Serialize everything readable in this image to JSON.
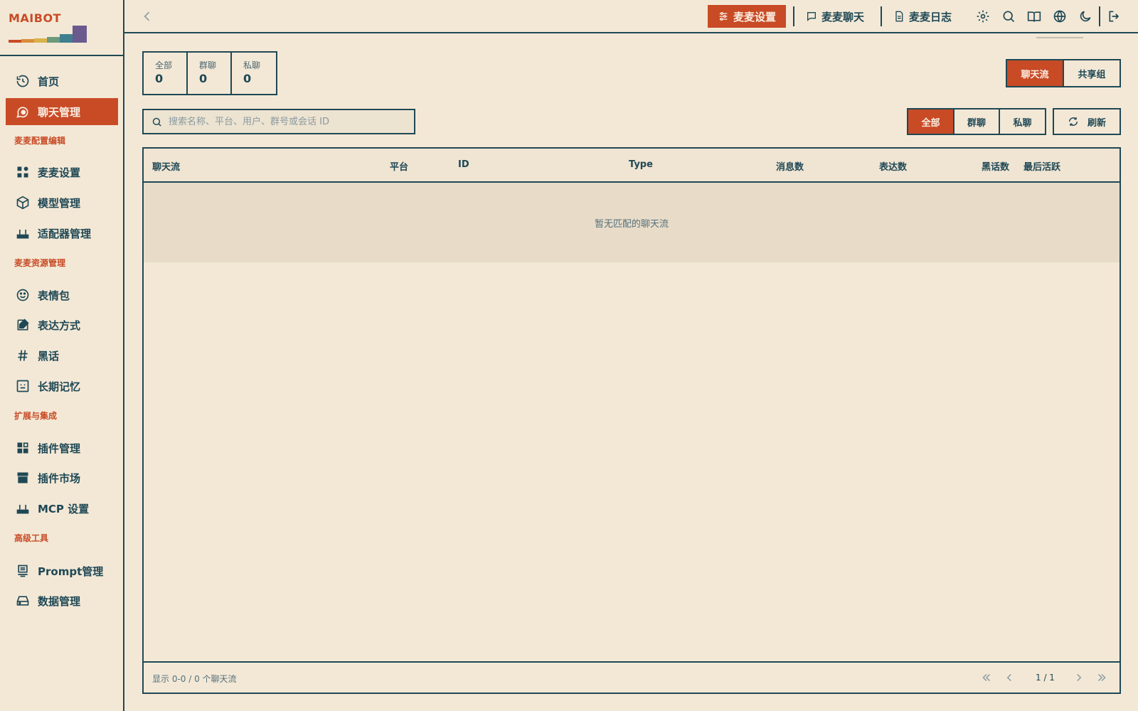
{
  "app": {
    "logo": "MAIBOT"
  },
  "colors": {
    "accent": "#c84b26",
    "ink": "#1f4855",
    "background": "#f3e8d6"
  },
  "sidebar": {
    "items": [
      {
        "label": "首页",
        "icon": "history-icon"
      },
      {
        "label": "聊天管理",
        "icon": "chat-bubble-icon",
        "active": true
      },
      {
        "label": "麦麦设置",
        "icon": "widgets-icon"
      },
      {
        "label": "模型管理",
        "icon": "cube-icon"
      },
      {
        "label": "适配器管理",
        "icon": "router-icon"
      },
      {
        "label": "表情包",
        "icon": "smile-icon"
      },
      {
        "label": "表达方式",
        "icon": "edit-note-icon"
      },
      {
        "label": "黑话",
        "icon": "hash-icon"
      },
      {
        "label": "长期记忆",
        "icon": "memory-icon"
      },
      {
        "label": "插件管理",
        "icon": "plugin-grid-icon"
      },
      {
        "label": "插件市场",
        "icon": "store-icon"
      },
      {
        "label": "MCP 设置",
        "icon": "router-icon"
      },
      {
        "label": "Prompt管理",
        "icon": "document-icon"
      },
      {
        "label": "数据管理",
        "icon": "drive-icon"
      }
    ],
    "sections": [
      "麦麦配置编辑",
      "麦麦资源管理",
      "扩展与集成",
      "高级工具"
    ]
  },
  "topbar": {
    "nav": [
      {
        "label": "麦麦设置",
        "icon": "sliders-icon",
        "active": true
      },
      {
        "label": "麦麦聊天",
        "icon": "message-icon"
      },
      {
        "label": "麦麦日志",
        "icon": "file-icon"
      }
    ],
    "icons": [
      "gear-icon",
      "search-icon",
      "book-icon",
      "globe-icon",
      "moon-icon",
      "logout-icon"
    ]
  },
  "stats": [
    {
      "label": "全部",
      "value": "0"
    },
    {
      "label": "群聊",
      "value": "0"
    },
    {
      "label": "私聊",
      "value": "0"
    }
  ],
  "view_toggle": {
    "options": [
      "聊天流",
      "共享组"
    ],
    "selected": "聊天流"
  },
  "filter": {
    "options": [
      "全部",
      "群聊",
      "私聊"
    ],
    "selected": "全部"
  },
  "search": {
    "placeholder": "搜索名称、平台、用户、群号或会话 ID",
    "value": ""
  },
  "refresh_label": "刷新",
  "table": {
    "columns": [
      "聊天流",
      "平台",
      "ID",
      "Type",
      "消息数",
      "表达数",
      "黑话数",
      "最后活跃"
    ],
    "empty_text": "暂无匹配的聊天流",
    "footer_info": "显示 0-0 / 0 个聊天流",
    "page": "1 / 1"
  }
}
